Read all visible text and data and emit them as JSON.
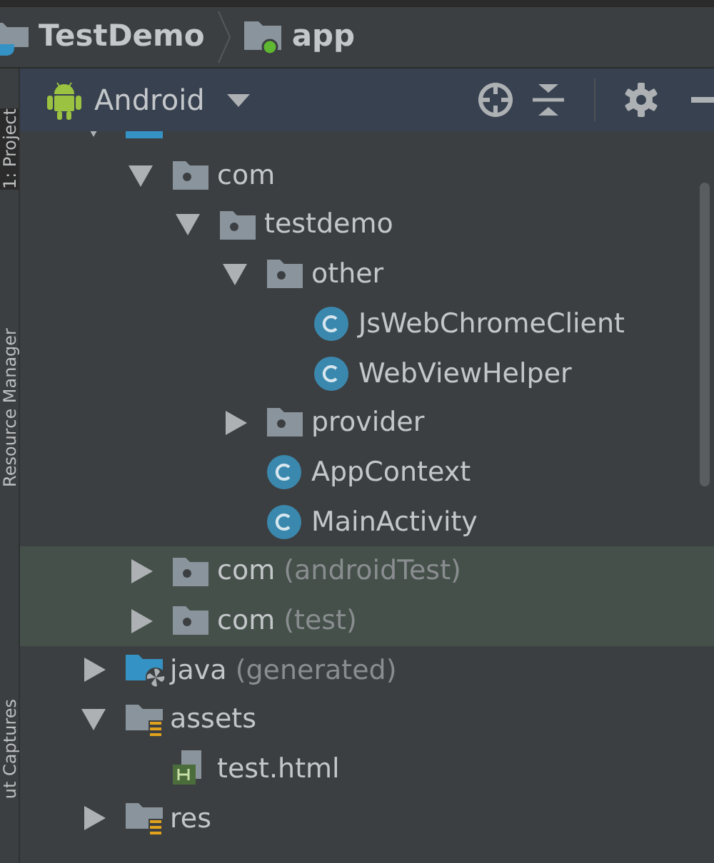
{
  "breadcrumb": [
    {
      "label": "TestDemo",
      "kind": "project"
    },
    {
      "label": "app",
      "kind": "module"
    }
  ],
  "toolbar": {
    "view": "Android"
  },
  "side_tabs": [
    {
      "label": "1: Project",
      "selected": true
    },
    {
      "label": "Resource Manager",
      "selected": false
    },
    {
      "label": "ut Captures",
      "selected": false
    }
  ],
  "tree": [
    {
      "kind": "java",
      "expanded": true,
      "highlighted": false,
      "children": [
        {
          "label": "com",
          "kind": "package",
          "expanded": true,
          "highlighted": false,
          "children": [
            {
              "label": "testdemo",
              "kind": "package",
              "expanded": true,
              "highlighted": false,
              "children": [
                {
                  "label": "other",
                  "kind": "package",
                  "expanded": true,
                  "highlighted": false,
                  "children": [
                    {
                      "label": "JsWebChromeClient",
                      "kind": "class",
                      "highlighted": false
                    },
                    {
                      "label": "WebViewHelper",
                      "kind": "class",
                      "highlighted": false
                    }
                  ]
                },
                {
                  "label": "provider",
                  "kind": "package",
                  "expanded": false,
                  "highlighted": false
                },
                {
                  "label": "AppContext",
                  "kind": "class",
                  "highlighted": false
                },
                {
                  "label": "MainActivity",
                  "kind": "class",
                  "highlighted": false
                }
              ]
            }
          ]
        },
        {
          "label": "com",
          "note": "(androidTest)",
          "kind": "package",
          "expanded": false,
          "highlighted": true
        },
        {
          "label": "com",
          "note": "(test)",
          "kind": "package",
          "expanded": false,
          "highlighted": true
        }
      ]
    },
    {
      "label": "java",
      "note": "(generated)",
      "kind": "generated",
      "expanded": false,
      "highlighted": false
    },
    {
      "label": "assets",
      "kind": "resfolder",
      "expanded": true,
      "highlighted": false,
      "children": [
        {
          "label": "test.html",
          "kind": "html",
          "highlighted": false
        }
      ]
    },
    {
      "label": "res",
      "kind": "resfolder",
      "expanded": false,
      "highlighted": false
    }
  ]
}
